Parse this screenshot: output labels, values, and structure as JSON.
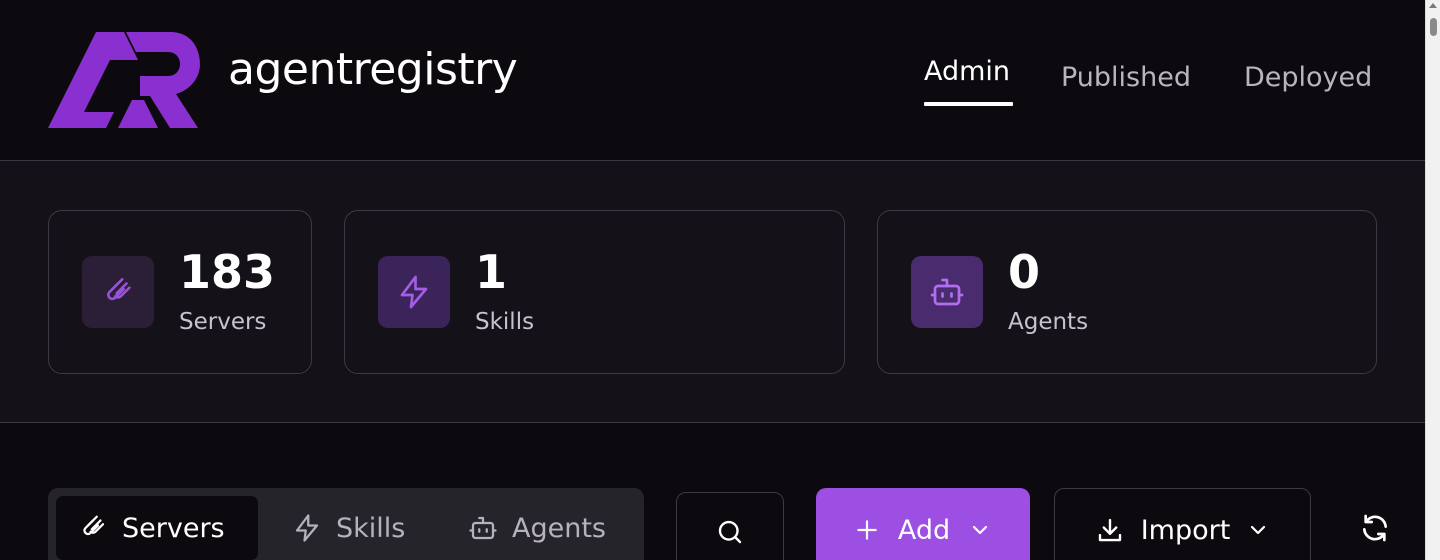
{
  "header": {
    "brand": "agentregistry",
    "logo_text": "AR",
    "nav": [
      {
        "label": "Admin",
        "active": true
      },
      {
        "label": "Published",
        "active": false
      },
      {
        "label": "Deployed",
        "active": false
      }
    ]
  },
  "stats": [
    {
      "value": "183",
      "label": "Servers",
      "icon": "server-icon"
    },
    {
      "value": "1",
      "label": "Skills",
      "icon": "lightning-icon"
    },
    {
      "value": "0",
      "label": "Agents",
      "icon": "bot-icon"
    }
  ],
  "toolbar": {
    "tabs": [
      {
        "label": "Servers",
        "icon": "server-icon",
        "active": true
      },
      {
        "label": "Skills",
        "icon": "lightning-icon",
        "active": false
      },
      {
        "label": "Agents",
        "icon": "bot-icon",
        "active": false
      }
    ],
    "search_icon": "search-icon",
    "add_label": "Add",
    "import_label": "Import",
    "refresh_icon": "refresh-icon"
  },
  "colors": {
    "accent": "#9d4fe3",
    "logo_purple": "#8a2fd0",
    "background": "#0c0a0e",
    "panel": "#141218",
    "border": "#3c3a42",
    "icon_bg_servers": "#2a1f36",
    "icon_bg_skills": "#3b2459",
    "icon_bg_agents": "#4a2b6e"
  }
}
